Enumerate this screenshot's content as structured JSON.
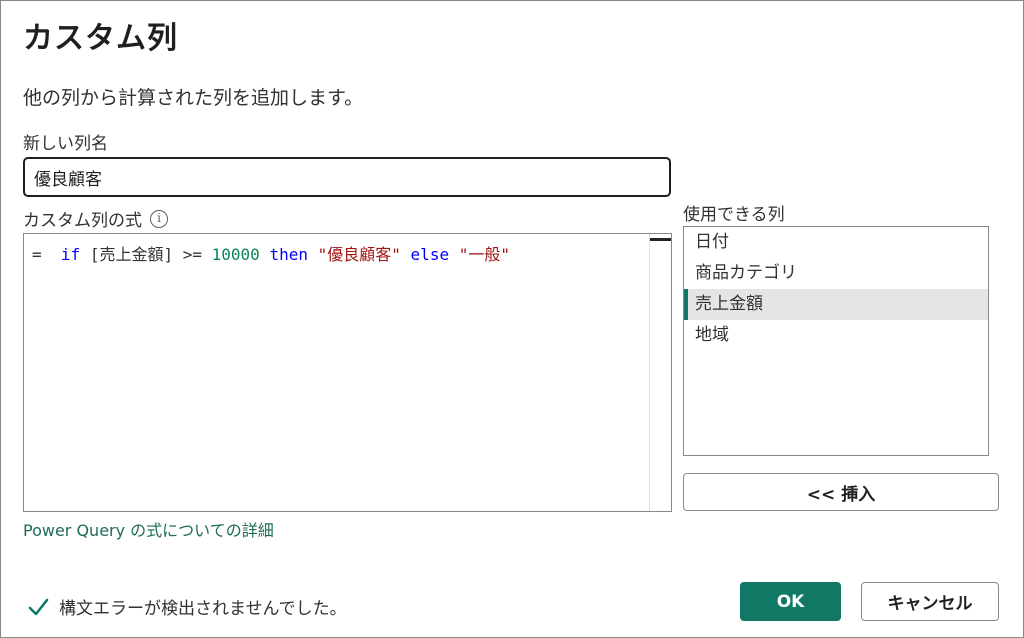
{
  "dialog": {
    "title": "カスタム列",
    "description": "他の列から計算された列を追加します。"
  },
  "name_field": {
    "label": "新しい列名",
    "value": "優良顧客"
  },
  "formula": {
    "label": "カスタム列の式",
    "info_icon": "i",
    "tokens": {
      "eq": "=",
      "kw_if": "if",
      "field": "[売上金額]",
      "op": ">=",
      "num": "10000",
      "kw_then": "then",
      "str_true": "\"優良顧客\"",
      "kw_else": "else",
      "str_false": "\"一般\""
    }
  },
  "columns": {
    "label": "使用できる列",
    "items": [
      {
        "label": "日付"
      },
      {
        "label": "商品カテゴリ"
      },
      {
        "label": "売上金額"
      },
      {
        "label": "地域"
      }
    ],
    "selected_index": 2
  },
  "insert_button": "<< 挿入",
  "help_link": "Power Query の式についての詳細",
  "status": {
    "text": "構文エラーが検出されませんでした。",
    "icon": "check-icon",
    "color": "#117865"
  },
  "buttons": {
    "ok": "OK",
    "cancel": "キャンセル"
  },
  "colors": {
    "accent": "#117865",
    "keyword": "#0000ff",
    "number": "#098658",
    "string": "#a31515"
  }
}
